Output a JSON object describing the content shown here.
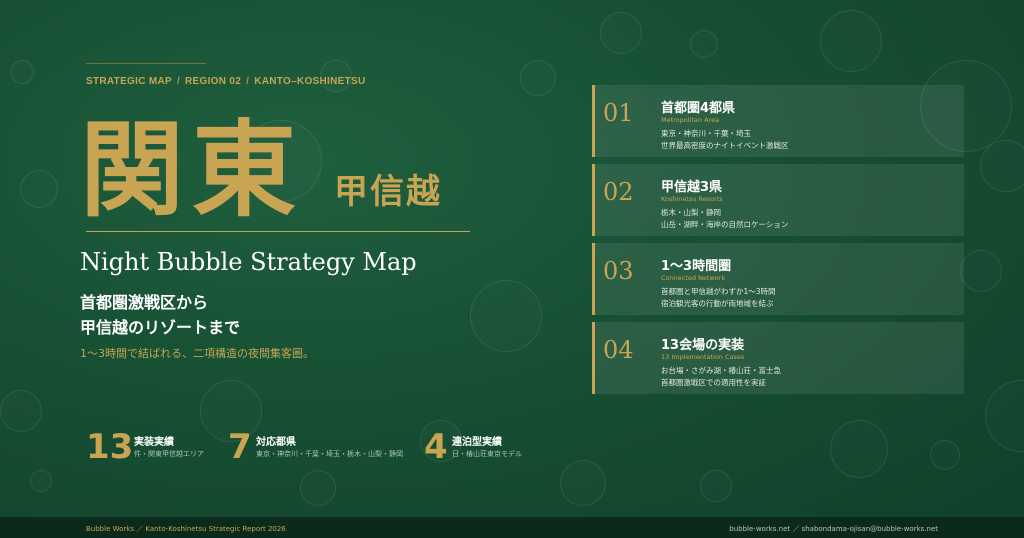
{
  "breadcrumb": [
    "STRATEGIC MAP",
    "REGION 02",
    "KANTO–KOSHINETSU"
  ],
  "title": {
    "main": "関東",
    "sub": "甲信越"
  },
  "english_title": "Night Bubble Strategy Map",
  "heading": {
    "line1": "首都圏激戦区から",
    "line2": "甲信越のリゾートまで"
  },
  "subheading": "1〜3時間で結ばれる、二項構造の夜間集客圏。",
  "stats": [
    {
      "number": "13",
      "label": "実装実績",
      "desc": "件・関東甲信越エリア"
    },
    {
      "number": "7",
      "label": "対応都県",
      "desc": "東京・神奈川・千葉・埼玉・栃木・山梨・静岡"
    },
    {
      "number": "4",
      "label": "連泊型実績",
      "desc": "日・椿山荘東京モデル"
    }
  ],
  "cards": [
    {
      "num": "01",
      "title": "首都圏4都県",
      "en": "Metropolitan Area",
      "line1": "東京・神奈川・千葉・埼玉",
      "line2": "世界最高密度のナイトイベント激戦区"
    },
    {
      "num": "02",
      "title": "甲信越3県",
      "en": "Koshinetsu Resorts",
      "line1": "栃木・山梨・静岡",
      "line2": "山岳・湖畔・海岸の自然ロケーション"
    },
    {
      "num": "03",
      "title": "1〜3時間圏",
      "en": "Connected Network",
      "line1": "首都圏と甲信越がわずか1〜3時間",
      "line2": "宿泊観光客の行動が両地域を結ぶ"
    },
    {
      "num": "04",
      "title": "13会場の実装",
      "en": "13 Implementation Cases",
      "line1": "お台場・さがみ湖・椿山荘・富士急",
      "line2": "首都圏激戦区での適用性を実証"
    }
  ],
  "footer": {
    "left": "Bubble Works ／ Kanto-Koshinetsu Strategic Report 2026",
    "right": "bubble-works.net ／ shabondama-ojisan@bubble-works.net"
  },
  "colors": {
    "background": "#174f33",
    "gold": "#c9a453",
    "footer_bg": "#0c2a1b"
  }
}
